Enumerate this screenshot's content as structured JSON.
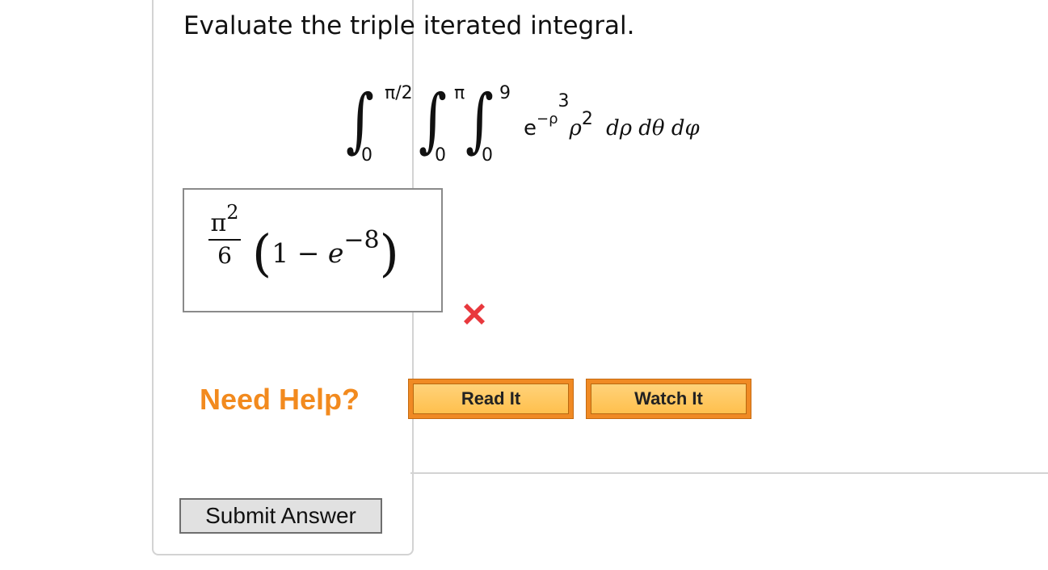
{
  "question": {
    "prompt": "Evaluate the triple iterated integral."
  },
  "integral": {
    "outer_upper": "π/2",
    "outer_lower": "0",
    "middle_upper": "π",
    "middle_lower": "0",
    "inner_upper": "9",
    "inner_lower": "0",
    "base_e": "e",
    "exp_sign": "−ρ",
    "exp_power": "3",
    "rho": "ρ",
    "rho_power": "2",
    "differentials": "dρ dθ dφ"
  },
  "answer": {
    "frac_num": "π",
    "frac_num_power": "2",
    "frac_den": "6",
    "open_paren": "(",
    "one": "1",
    "minus": "−",
    "e": "e",
    "e_power": "−8",
    "close_paren": ")",
    "status": "incorrect",
    "status_color": "#e8383d"
  },
  "help": {
    "label": "Need Help?",
    "read_label": "Read It",
    "watch_label": "Watch It"
  },
  "submit": {
    "label": "Submit Answer"
  }
}
